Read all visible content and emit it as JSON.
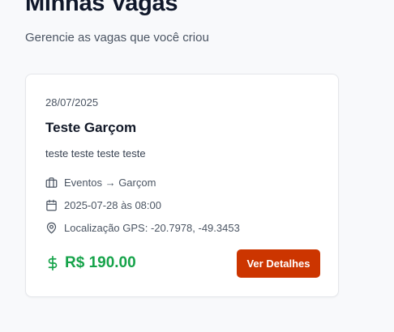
{
  "header": {
    "title": "Minhas Vagas",
    "subtitle": "Gerencie as vagas que você criou"
  },
  "job_card": {
    "date": "28/07/2025",
    "title": "Teste Garçom",
    "description": "teste teste teste teste",
    "category": "Eventos → Garçom",
    "datetime": "2025-07-28 às 08:00",
    "location": "Localização GPS: -20.7978, -49.3453",
    "price": "R$ 190.00",
    "details_label": "Ver Detalhes",
    "icons": {
      "category": "briefcase-icon",
      "datetime": "calendar-icon",
      "location": "map-pin-icon",
      "price": "dollar-icon"
    }
  },
  "colors": {
    "accent": "#cc3500",
    "price": "#16a34a",
    "background": "#f8f9fb"
  }
}
